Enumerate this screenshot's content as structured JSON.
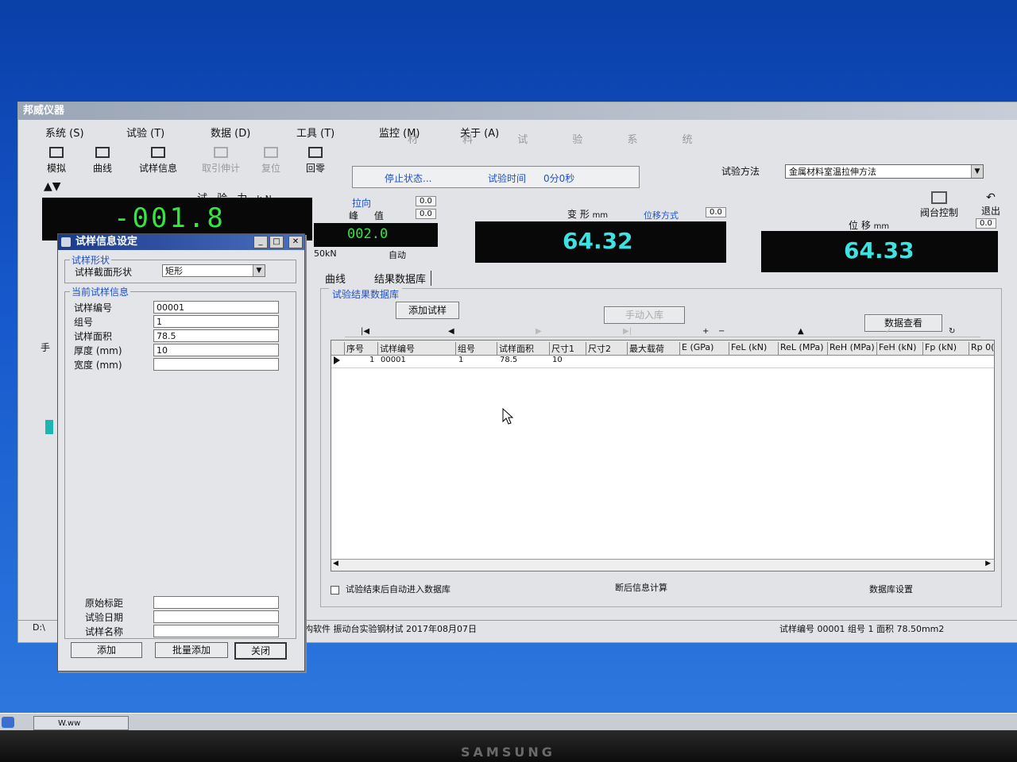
{
  "app": {
    "title": "邦威仪器",
    "banner": "材 料 试 验 系 统",
    "menu": [
      "系统 (S)",
      "试验 (T)",
      "数据 (D)",
      "工具 (T)",
      "监控 (M)",
      "关于 (A)"
    ],
    "toolbar": [
      {
        "label": "模拟",
        "icon": "simulate-icon",
        "enabled": true
      },
      {
        "label": "曲线",
        "icon": "curve-icon",
        "enabled": true
      },
      {
        "label": "试样信息",
        "icon": "sample-info-icon",
        "enabled": true
      },
      {
        "label": "取引伸计",
        "icon": "extensometer-icon",
        "enabled": false
      },
      {
        "label": "复位",
        "icon": "reset-icon",
        "enabled": false
      },
      {
        "label": "回零",
        "icon": "zero-icon",
        "enabled": true
      }
    ],
    "status": {
      "state": "停止状态...",
      "time_label": "试验时间",
      "time_value": "0分0秒"
    },
    "method": {
      "label": "试验方法",
      "value": "金属材料室温拉伸方法"
    },
    "right_tools": [
      "阀台控制",
      "退出"
    ]
  },
  "readouts": {
    "force": {
      "label": "试 验 力",
      "unit": "kN",
      "value": "-001.8"
    },
    "peak": {
      "direction": "拉向",
      "label": "峰 值",
      "value": "002.0",
      "range": "50kN",
      "mode": "自动",
      "small_a": "0.0",
      "small_b": "0.0"
    },
    "deformation": {
      "label": "变 形",
      "unit": "mm",
      "mode": "位移方式",
      "value": "64.32",
      "small": "0.0"
    },
    "displacement": {
      "label": "位 移",
      "unit": "mm",
      "value": "64.33",
      "small": "0.0"
    }
  },
  "tabs": [
    "曲线",
    "结果数据库"
  ],
  "database": {
    "legend": "试验结果数据库",
    "add_button": "添加试样",
    "manual_button": "手动入库",
    "view_button": "数据查看",
    "columns": [
      "序号",
      "试样编号",
      "组号",
      "试样面积",
      "尺寸1",
      "尺寸2",
      "最大载荷",
      "E (GPa)",
      "FeL (kN)",
      "ReL (MPa)",
      "ReH (MPa)",
      "FeH (kN)",
      "Fp (kN)",
      "Rp 0("
    ],
    "rows": [
      [
        "1",
        "00001",
        "1",
        "78.5",
        "10",
        "",
        "",
        "",
        "",
        "",
        "",
        "",
        "",
        ""
      ]
    ],
    "auto_db_label": "试验结束后自动进入数据库",
    "post_calc_label": "断后信息计算",
    "db_settings_label": "数据库设置"
  },
  "statusbar": {
    "left": "D:\\",
    "middle": "构软件 振动台实验钢材试 2017年08月07日",
    "right": "试样编号 00001 组号 1 面积 78.50mm2"
  },
  "dialog": {
    "title": "试样信息设定",
    "shape_legend": "试样形状",
    "shape_label": "试样截面形状",
    "shape_value": "矩形",
    "current_legend": "当前试样信息",
    "fields": [
      {
        "label": "试样编号",
        "value": "00001"
      },
      {
        "label": "组号",
        "value": "1"
      },
      {
        "label": "试样面积",
        "value": "78.5"
      },
      {
        "label": "厚度 (mm)",
        "value": "10"
      },
      {
        "label": "宽度 (mm)",
        "value": ""
      }
    ],
    "bottom_fields": [
      {
        "label": "原始标距",
        "value": ""
      },
      {
        "label": "试验日期",
        "value": ""
      },
      {
        "label": "试样名称",
        "value": ""
      }
    ],
    "buttons": [
      "添加",
      "批量添加",
      "关闭"
    ]
  },
  "taskbar": {
    "item": "W.ww"
  },
  "bezel": {
    "brand": "SAMSUNG"
  },
  "left_strip": {
    "label": "手"
  }
}
